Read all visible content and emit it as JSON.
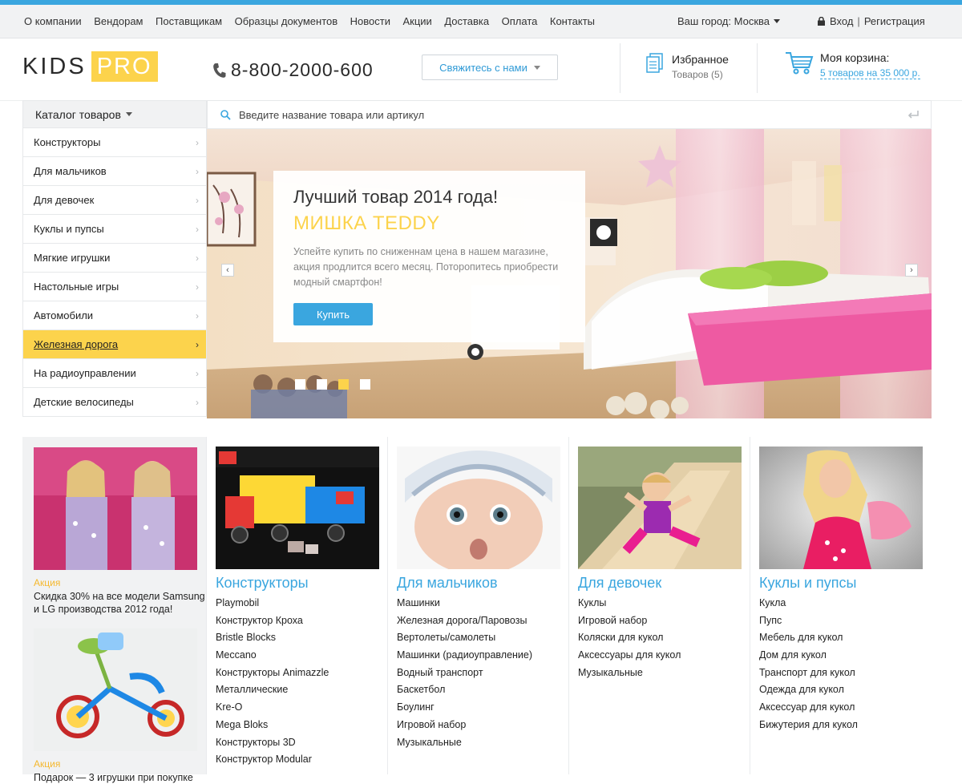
{
  "topnav": {
    "links": [
      "О компании",
      "Вендорам",
      "Поставщикам",
      "Образцы документов",
      "Новости",
      "Акции",
      "Доставка",
      "Оплата",
      "Контакты"
    ],
    "city": "Ваш город: Москва",
    "login": "Вход",
    "register": "Регистрация"
  },
  "header": {
    "logo_kids": "KIDS",
    "logo_pro": "PRO",
    "phone": "8-800-2000-600",
    "contact_button": "Свяжитесь с нами",
    "favorites_title": "Избранное",
    "favorites_count": "Товаров (5)",
    "cart_title": "Моя корзина:",
    "cart_summary": "5 товаров на 35 000 р."
  },
  "catalog": {
    "title": "Каталог товаров",
    "items": [
      {
        "label": "Конструкторы",
        "active": false
      },
      {
        "label": "Для мальчиков",
        "active": false
      },
      {
        "label": "Для девочек",
        "active": false
      },
      {
        "label": "Куклы и пупсы",
        "active": false
      },
      {
        "label": "Мягкие игрушки",
        "active": false
      },
      {
        "label": "Настольные игры",
        "active": false
      },
      {
        "label": "Автомобили",
        "active": false
      },
      {
        "label": "Железная дорога",
        "active": true
      },
      {
        "label": "На радиоуправлении",
        "active": false
      },
      {
        "label": "Детские велосипеды",
        "active": false
      }
    ]
  },
  "search": {
    "placeholder": "Введите название товара или артикул"
  },
  "banner": {
    "heading": "Лучший товар 2014 года!",
    "product": "МИШКА TEDDY",
    "description": "Успейте купить  по сниженнам цена  в нашем магазине, акция продлится всего месяц. Поторопитесь приобрести модный смартфон!",
    "buy_button": "Купить",
    "slide_count": 4,
    "active_slide": 2
  },
  "promos": [
    {
      "tag": "Акция",
      "text": "Скидка 30% на все модели Samsung и LG производства 2012 года!"
    },
    {
      "tag": "Акция",
      "text": "Подарок — 3 игрушки при покупке"
    }
  ],
  "categories": [
    {
      "title": "Конструкторы",
      "items": [
        "Playmobil",
        "Конструктор Кроха",
        "Bristle Blocks",
        "Meccano",
        "Конструкторы Animazzle",
        "Металлические",
        "Kre-O",
        "Mega Bloks",
        "Конструкторы 3D",
        "Конструктор Modular"
      ]
    },
    {
      "title": "Для мальчиков",
      "items": [
        "Машинки",
        "Железная дорога/Паровозы",
        "Вертолеты/самолеты",
        "Машинки (радиоуправление)",
        "Водный транспорт",
        "Баскетбол",
        "Боулинг",
        "Игровой набор",
        "Музыкальные"
      ]
    },
    {
      "title": "Для девочек",
      "items": [
        "Куклы",
        "Игровой набор",
        "Коляски для кукол",
        "Аксессуары для кукол",
        "Музыкальные"
      ]
    },
    {
      "title": "Куклы и пупсы",
      "items": [
        "Кукла",
        "Пупс",
        "Мебель для кукол",
        "Дом для кукол",
        "Транспорт для кукол",
        "Одежда для кукол",
        "Аксессуар для кукол",
        "Бижутерия для кукол"
      ]
    }
  ],
  "colors": {
    "accent": "#3aa6df",
    "brand_yellow": "#fcd34c",
    "promo_tag": "#f5b82e"
  }
}
